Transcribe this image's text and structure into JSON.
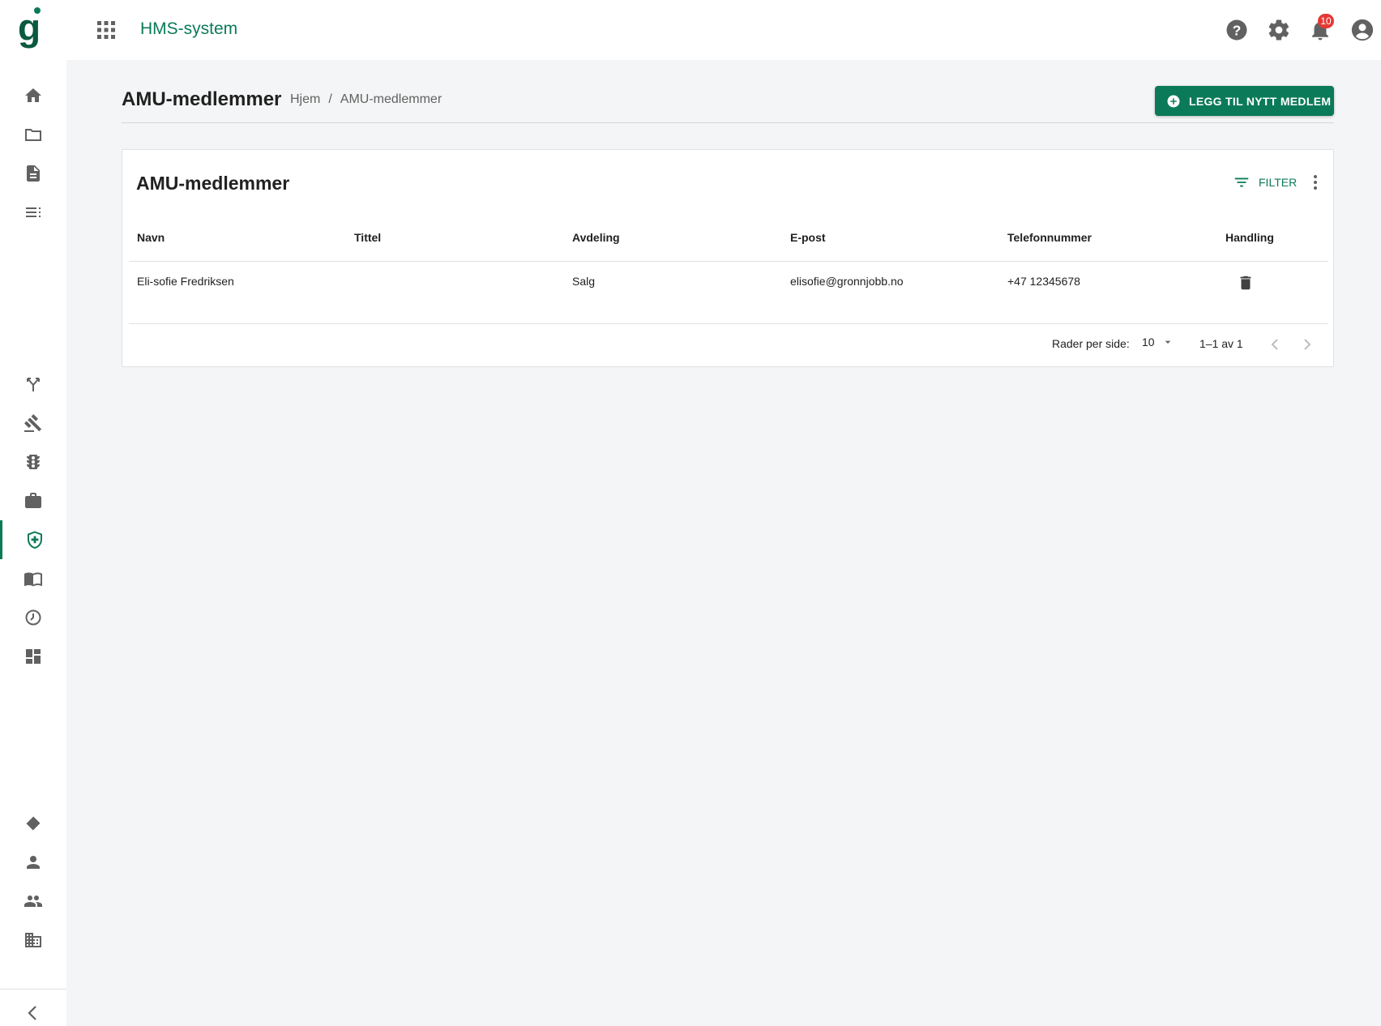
{
  "topbar": {
    "app_title": "HMS-system",
    "icons": [
      "apps-icon",
      "help-icon",
      "settings-icon",
      "notifications-icon",
      "account-icon"
    ],
    "notification_count": "10"
  },
  "sidenav": {
    "items": [
      "home-icon",
      "folder-icon",
      "document-icon",
      "checklist-icon",
      "fork-icon",
      "gavel-icon",
      "traffic-light-icon",
      "briefcase-icon",
      "health-shield-icon",
      "manual-book-icon",
      "timer-icon",
      "dashboard-icon",
      "handshake-icon",
      "person-icon",
      "group-icon",
      "building-icon",
      "collapse-chevron-icon"
    ],
    "active_item": "health-shield-icon"
  },
  "page": {
    "title": "AMU-medlemmer",
    "breadcrumb": {
      "home": "Hjem",
      "separator": "/",
      "current": "AMU-medlemmer"
    },
    "add_button_label": "LEGG TIL NYTT MEDLEM"
  },
  "card": {
    "title": "AMU-medlemmer",
    "filter_label": "FILTER",
    "columns": [
      "Navn",
      "Tittel",
      "Avdeling",
      "E-post",
      "Telefonnummer",
      "Handling"
    ],
    "rows": [
      {
        "name": "Eli-sofie Fredriksen",
        "title": "",
        "department": "Salg",
        "email": "elisofie@gronnjobb.no",
        "phone": "+47 12345678"
      }
    ],
    "pagination": {
      "rows_per_page_label": "Rader per side:",
      "rows_per_page_value": "10",
      "range_label": "1–1 av 1"
    }
  },
  "colors": {
    "brand": "#0b7a58",
    "background": "#f4f5f6",
    "badge": "#e53935"
  }
}
